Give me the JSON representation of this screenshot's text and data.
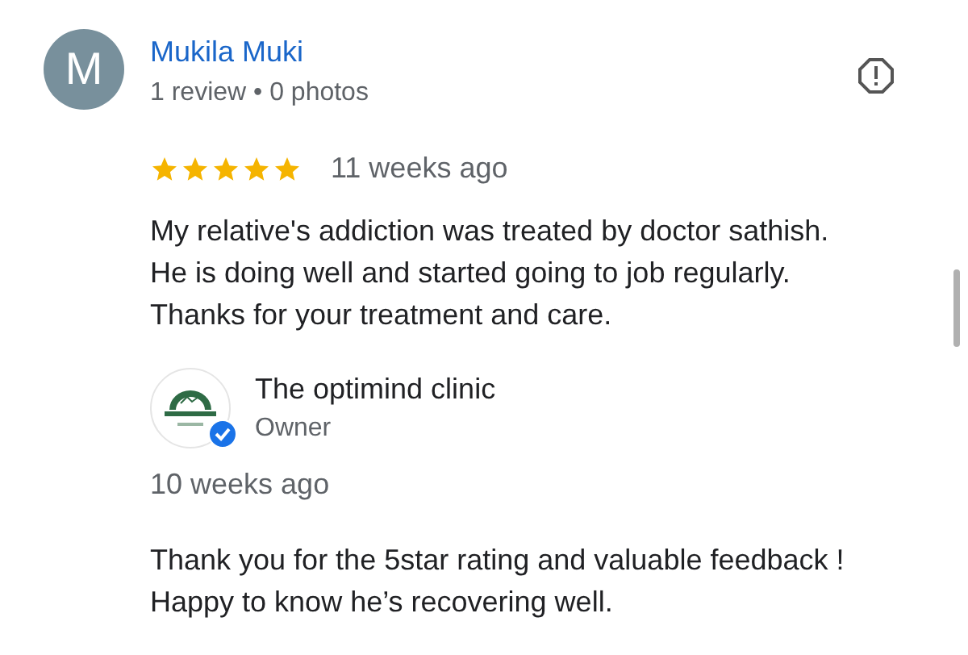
{
  "review": {
    "avatar_letter": "M",
    "author": "Mukila Muki",
    "meta": "1 review • 0 photos",
    "stars": 5,
    "time": "11 weeks ago",
    "text": [
      "My relative's addiction was treated by doctor sathish.",
      "He is doing well and started going to job regularly.",
      "Thanks for your treatment and care."
    ]
  },
  "owner_reply": {
    "name": "The optimind clinic",
    "role": "Owner",
    "verified": true,
    "time": "10 weeks ago",
    "text": [
      "Thank you for the 5star rating and valuable feedback !",
      "Happy to know he’s recovering well."
    ]
  }
}
